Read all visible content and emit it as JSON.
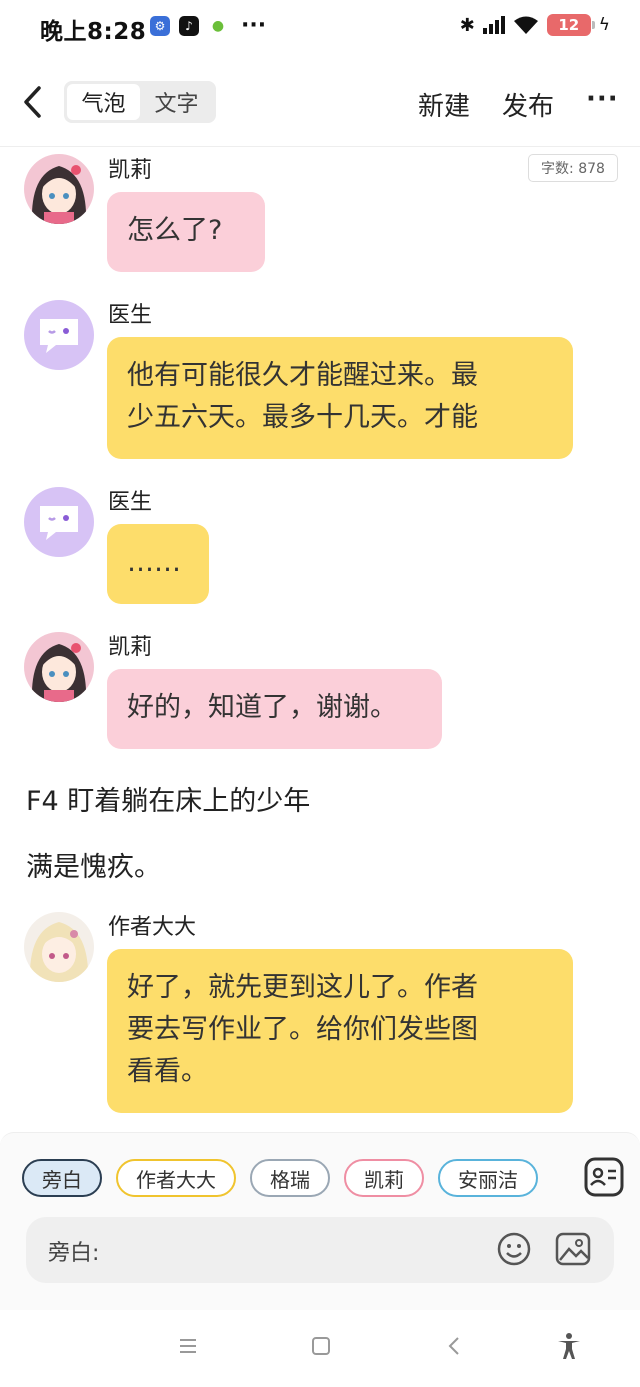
{
  "status_bar": {
    "time": "晚上8:28",
    "battery": "12",
    "icons": [
      "settings-icon",
      "tiktok-icon",
      "wechat-icon",
      "more-dots-icon",
      "bluetooth-icon",
      "signal-icon",
      "wifi-icon",
      "battery-icon",
      "charging-icon"
    ]
  },
  "header": {
    "tabs": [
      {
        "label": "气泡",
        "active": true
      },
      {
        "label": "文字",
        "active": false
      }
    ],
    "new_label": "新建",
    "publish_label": "发布",
    "more_label": "···"
  },
  "word_count": "字数: 878",
  "messages": [
    {
      "speaker": "凯莉",
      "text": "怎么了?",
      "bubble_color": "#fbcfd9"
    },
    {
      "speaker": "医生",
      "lines": [
        "他有可能很久才能醒过来。最",
        "少五六天。最多十几天。才能"
      ],
      "bubble_color": "#fddd6b"
    },
    {
      "speaker": "医生",
      "text": "……",
      "bubble_color": "#fddd6b"
    },
    {
      "speaker": "凯莉",
      "text": "好的，知道了，谢谢。",
      "bubble_color": "#fbcfd9"
    }
  ],
  "narration": [
    "F4 盯着躺在床上的少年",
    "满是愧疚。"
  ],
  "author_message": {
    "speaker": "作者大大",
    "lines": [
      "好了，就先更到这儿了。作者",
      "要去写作业了。给你们发些图",
      "看看。"
    ],
    "bubble_color": "#fddd6b"
  },
  "composer": {
    "roles": [
      {
        "label": "旁白",
        "selected": true
      },
      {
        "label": "作者大大",
        "selected": false
      },
      {
        "label": "格瑞",
        "selected": false
      },
      {
        "label": "凯莉",
        "selected": false
      },
      {
        "label": "安丽洁",
        "selected": false
      }
    ],
    "input_label": "旁白:"
  },
  "nav_bar": {
    "icons": [
      "menu-icon",
      "home-icon",
      "back-icon",
      "accessibility-icon"
    ]
  }
}
